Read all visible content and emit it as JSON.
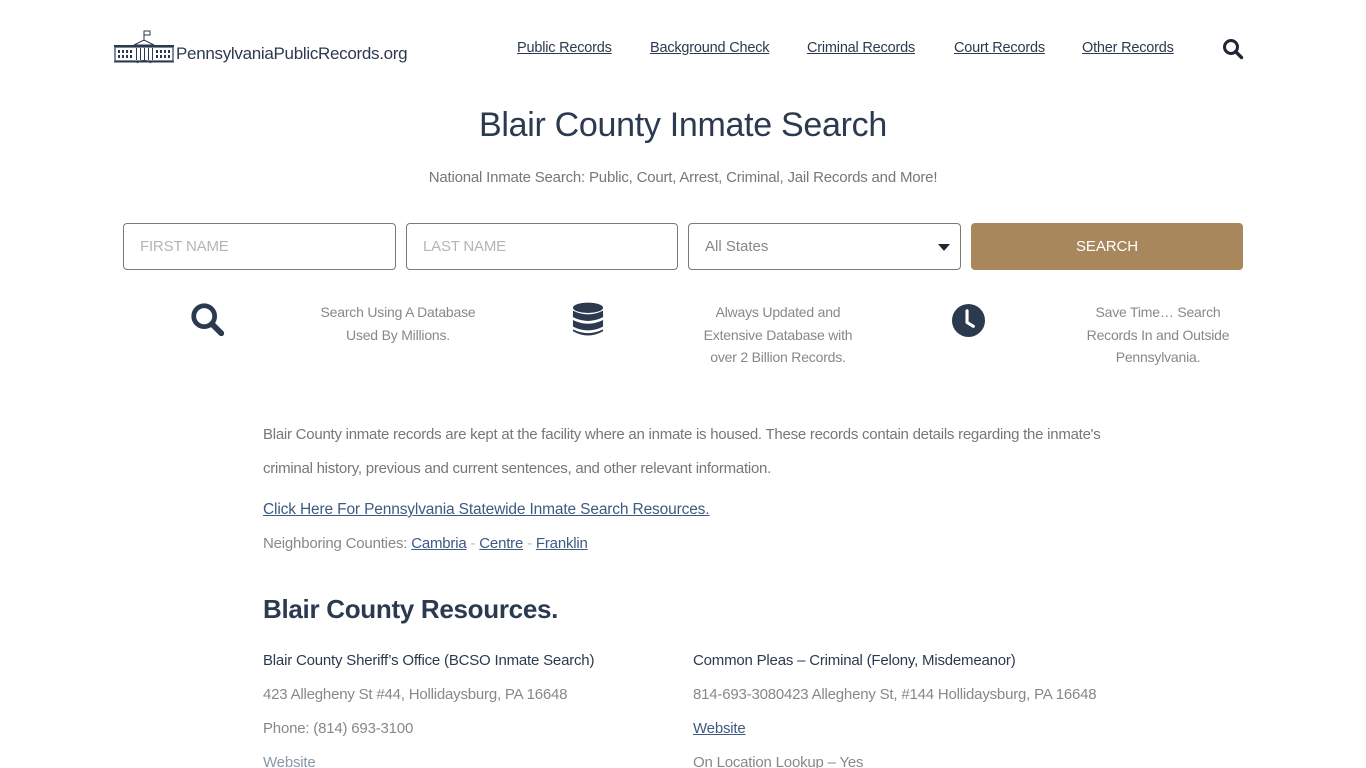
{
  "header": {
    "logo_text": "PennsylvaniaPublicRecords.org",
    "nav": [
      {
        "label": "Public Records"
      },
      {
        "label": "Background Check"
      },
      {
        "label": "Criminal Records"
      },
      {
        "label": "Court Records"
      },
      {
        "label": "Other Records"
      }
    ],
    "search_icon": "search-icon"
  },
  "hero": {
    "title": "Blair County Inmate Search",
    "subtitle": "National Inmate Search: Public, Court, Arrest, Criminal, Jail Records and More!"
  },
  "search_form": {
    "first_name_placeholder": "FIRST NAME",
    "last_name_placeholder": "LAST NAME",
    "state_selected": "All States",
    "search_label": "SEARCH",
    "accent_color": "#a8875c"
  },
  "features": [
    {
      "icon": "search-icon",
      "text_line1": "Search Using A Database",
      "text_line2": "Used By Millions.",
      "text_line3": ""
    },
    {
      "icon": "database-icon",
      "text_line1": "Always Updated and",
      "text_line2": "Extensive Database with",
      "text_line3": "over 2 Billion Records."
    },
    {
      "icon": "clock-icon",
      "text_line1": "Save Time… Search",
      "text_line2": "Records In and Outside",
      "text_line3": "Pennsylvania."
    }
  ],
  "content": {
    "intro_line1": "Blair County inmate records are kept at the facility where an inmate is housed. These records contain details regarding the inmate's",
    "intro_line2": "criminal history, previous and current sentences, and other relevant information.",
    "statewide_link": "Click Here For Pennsylvania Statewide Inmate Search Resources.",
    "neighbors_label": "Neighboring Counties:",
    "neighbors": [
      "Cambria",
      "Centre",
      "Franklin"
    ],
    "neighbor_separator": "-",
    "resources_title": "Blair County Resources."
  },
  "resources": [
    {
      "name": "Blair County Sheriff’s Office (BCSO Inmate Search)",
      "address": "423 Allegheny St #44, Hollidaysburg, PA 16648",
      "phone": "Phone: (814) 693-3100",
      "website_label": "Website"
    },
    {
      "name": "Common Pleas – Criminal (Felony, Misdemeanor)",
      "address": "814-693-3080423 Allegheny St, #144 Hollidaysburg, PA 16648",
      "website_label": "Website",
      "lookup": "On Location Lookup – Yes"
    }
  ]
}
